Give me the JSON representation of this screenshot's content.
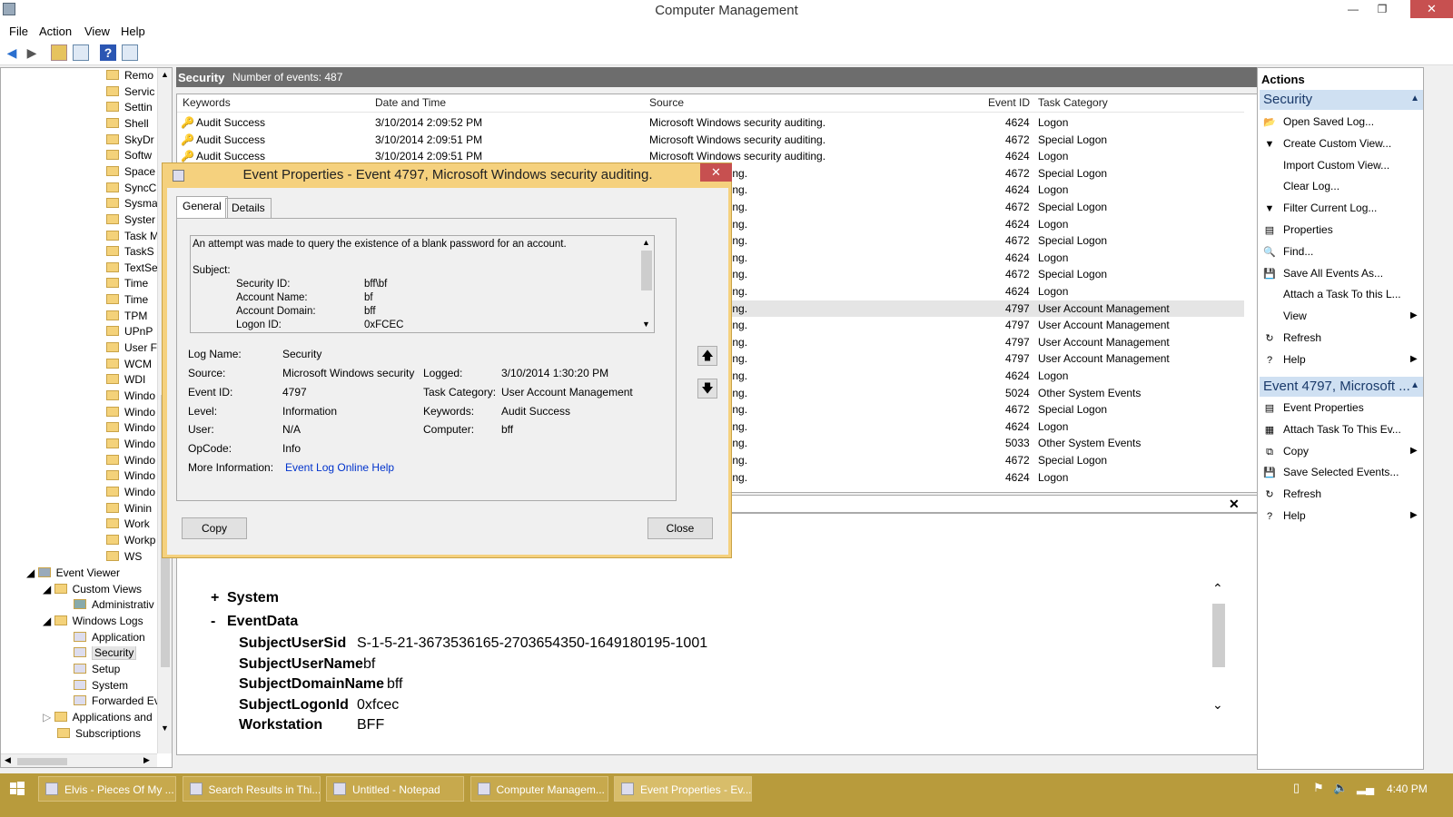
{
  "window": {
    "title": "Computer Management"
  },
  "menu": [
    "File",
    "Action",
    "View",
    "Help"
  ],
  "tree": {
    "folders": [
      "Remo",
      "Servic",
      "Settin",
      "Shell",
      "SkyDr",
      "Softw",
      "Space",
      "SyncC",
      "Sysma",
      "Syster",
      "Task M",
      "TaskS",
      "TextSe",
      "Time",
      "Time",
      "TPM",
      "UPnP",
      "User F",
      "WCM",
      "WDI",
      "Windo",
      "Windo",
      "Windo",
      "Windo",
      "Windo",
      "Windo",
      "Windo",
      "Winin",
      "Work",
      "Workp",
      "WS"
    ],
    "event_viewer": "Event Viewer",
    "custom_views": "Custom Views",
    "administrative": "Administrativ",
    "windows_logs": "Windows Logs",
    "application": "Application",
    "security": "Security",
    "setup": "Setup",
    "system": "System",
    "forwarded": "Forwarded Ev",
    "apps_and": "Applications and",
    "subscriptions": "Subscriptions"
  },
  "log_header": {
    "name": "Security",
    "count": "Number of events: 487"
  },
  "columns": {
    "keywords": "Keywords",
    "datetime": "Date and Time",
    "source": "Source",
    "eventid": "Event ID",
    "category": "Task Category"
  },
  "rows": [
    {
      "kw": "Audit Success",
      "dt": "3/10/2014 2:09:52 PM",
      "src": "Microsoft Windows security auditing.",
      "id": "4624",
      "cat": "Logon"
    },
    {
      "kw": "Audit Success",
      "dt": "3/10/2014 2:09:51 PM",
      "src": "Microsoft Windows security auditing.",
      "id": "4672",
      "cat": "Special Logon"
    },
    {
      "kw": "Audit Success",
      "dt": "3/10/2014 2:09:51 PM",
      "src": "Microsoft Windows security auditing.",
      "id": "4624",
      "cat": "Logon"
    },
    {
      "kw": "",
      "dt": "",
      "src": "ws security auditing.",
      "id": "4672",
      "cat": "Special Logon"
    },
    {
      "kw": "",
      "dt": "",
      "src": "ws security auditing.",
      "id": "4624",
      "cat": "Logon"
    },
    {
      "kw": "",
      "dt": "",
      "src": "ws security auditing.",
      "id": "4672",
      "cat": "Special Logon"
    },
    {
      "kw": "",
      "dt": "",
      "src": "ws security auditing.",
      "id": "4624",
      "cat": "Logon"
    },
    {
      "kw": "",
      "dt": "",
      "src": "ws security auditing.",
      "id": "4672",
      "cat": "Special Logon"
    },
    {
      "kw": "",
      "dt": "",
      "src": "ws security auditing.",
      "id": "4624",
      "cat": "Logon"
    },
    {
      "kw": "",
      "dt": "",
      "src": "ws security auditing.",
      "id": "4672",
      "cat": "Special Logon"
    },
    {
      "kw": "",
      "dt": "",
      "src": "ws security auditing.",
      "id": "4624",
      "cat": "Logon"
    },
    {
      "kw": "",
      "dt": "",
      "src": "ws security auditing.",
      "id": "4797",
      "cat": "User Account Management"
    },
    {
      "kw": "",
      "dt": "",
      "src": "ws security auditing.",
      "id": "4797",
      "cat": "User Account Management"
    },
    {
      "kw": "",
      "dt": "",
      "src": "ws security auditing.",
      "id": "4797",
      "cat": "User Account Management"
    },
    {
      "kw": "",
      "dt": "",
      "src": "ws security auditing.",
      "id": "4797",
      "cat": "User Account Management"
    },
    {
      "kw": "",
      "dt": "",
      "src": "ws security auditing.",
      "id": "4624",
      "cat": "Logon"
    },
    {
      "kw": "",
      "dt": "",
      "src": "ws security auditing.",
      "id": "5024",
      "cat": "Other System Events"
    },
    {
      "kw": "",
      "dt": "",
      "src": "ws security auditing.",
      "id": "4672",
      "cat": "Special Logon"
    },
    {
      "kw": "",
      "dt": "",
      "src": "ws security auditing.",
      "id": "4624",
      "cat": "Logon"
    },
    {
      "kw": "",
      "dt": "",
      "src": "ws security auditing.",
      "id": "5033",
      "cat": "Other System Events"
    },
    {
      "kw": "",
      "dt": "",
      "src": "ws security auditing.",
      "id": "4672",
      "cat": "Special Logon"
    },
    {
      "kw": "",
      "dt": "",
      "src": "ws security auditing.",
      "id": "4624",
      "cat": "Logon"
    }
  ],
  "xml": {
    "system": "System",
    "eventdata": "EventData",
    "plus": "+",
    "minus": "-",
    "fields": [
      {
        "k": "SubjectUserSid",
        "v": "S-1-5-21-3673536165-2703654350-1649180195-1001"
      },
      {
        "k": "SubjectUserName",
        "v": "bf"
      },
      {
        "k": "SubjectDomainName",
        "v": "bff"
      },
      {
        "k": "SubjectLogonId",
        "v": "0xfcec"
      },
      {
        "k": "Workstation",
        "v": "BFF"
      }
    ]
  },
  "actions": {
    "header": "Actions",
    "section1": "Security",
    "items1": [
      "Open Saved Log...",
      "Create Custom View...",
      "Import Custom View...",
      "Clear Log...",
      "Filter Current Log...",
      "Properties",
      "Find...",
      "Save All Events As...",
      "Attach a Task To this L...",
      "View",
      "Refresh",
      "Help"
    ],
    "section2": "Event 4797, Microsoft ...",
    "items2": [
      "Event Properties",
      "Attach Task To This Ev...",
      "Copy",
      "Save Selected Events...",
      "Refresh",
      "Help"
    ]
  },
  "dialog": {
    "title": "Event Properties - Event 4797, Microsoft Windows security auditing.",
    "tab_general": "General",
    "tab_details": "Details",
    "description": "An attempt was made to query the existence of a blank password for an account.",
    "subject": "Subject:",
    "sec_id_label": "Security ID:",
    "sec_id": "bff\\bf",
    "acct_name_label": "Account Name:",
    "acct_name": "bf",
    "acct_domain_label": "Account Domain:",
    "acct_domain": "bff",
    "logon_id_label": "Logon ID:",
    "logon_id": "0xFCEC",
    "log_name_label": "Log Name:",
    "log_name": "Security",
    "source_label": "Source:",
    "source": "Microsoft Windows security",
    "logged_label": "Logged:",
    "logged": "3/10/2014 1:30:20 PM",
    "event_id_label": "Event ID:",
    "event_id": "4797",
    "task_cat_label": "Task Category:",
    "task_cat": "User Account Management",
    "level_label": "Level:",
    "level": "Information",
    "keywords_label": "Keywords:",
    "keywords": "Audit Success",
    "user_label": "User:",
    "user": "N/A",
    "computer_label": "Computer:",
    "computer": "bff",
    "opcode_label": "OpCode:",
    "opcode": "Info",
    "more_info_label": "More Information:",
    "more_info": "Event Log Online Help",
    "copy": "Copy",
    "close": "Close"
  },
  "taskbar": {
    "tasks": [
      "Elvis - Pieces Of My ...",
      "Search Results in Thi...",
      "Untitled - Notepad",
      "Computer Managem...",
      "Event Properties - Ev..."
    ],
    "time": "4:40 PM"
  },
  "colors": {
    "accent": "#f5d17e",
    "taskbar": "#b89b3c",
    "action_section": "#cfe0f2",
    "link": "#0033cc"
  }
}
